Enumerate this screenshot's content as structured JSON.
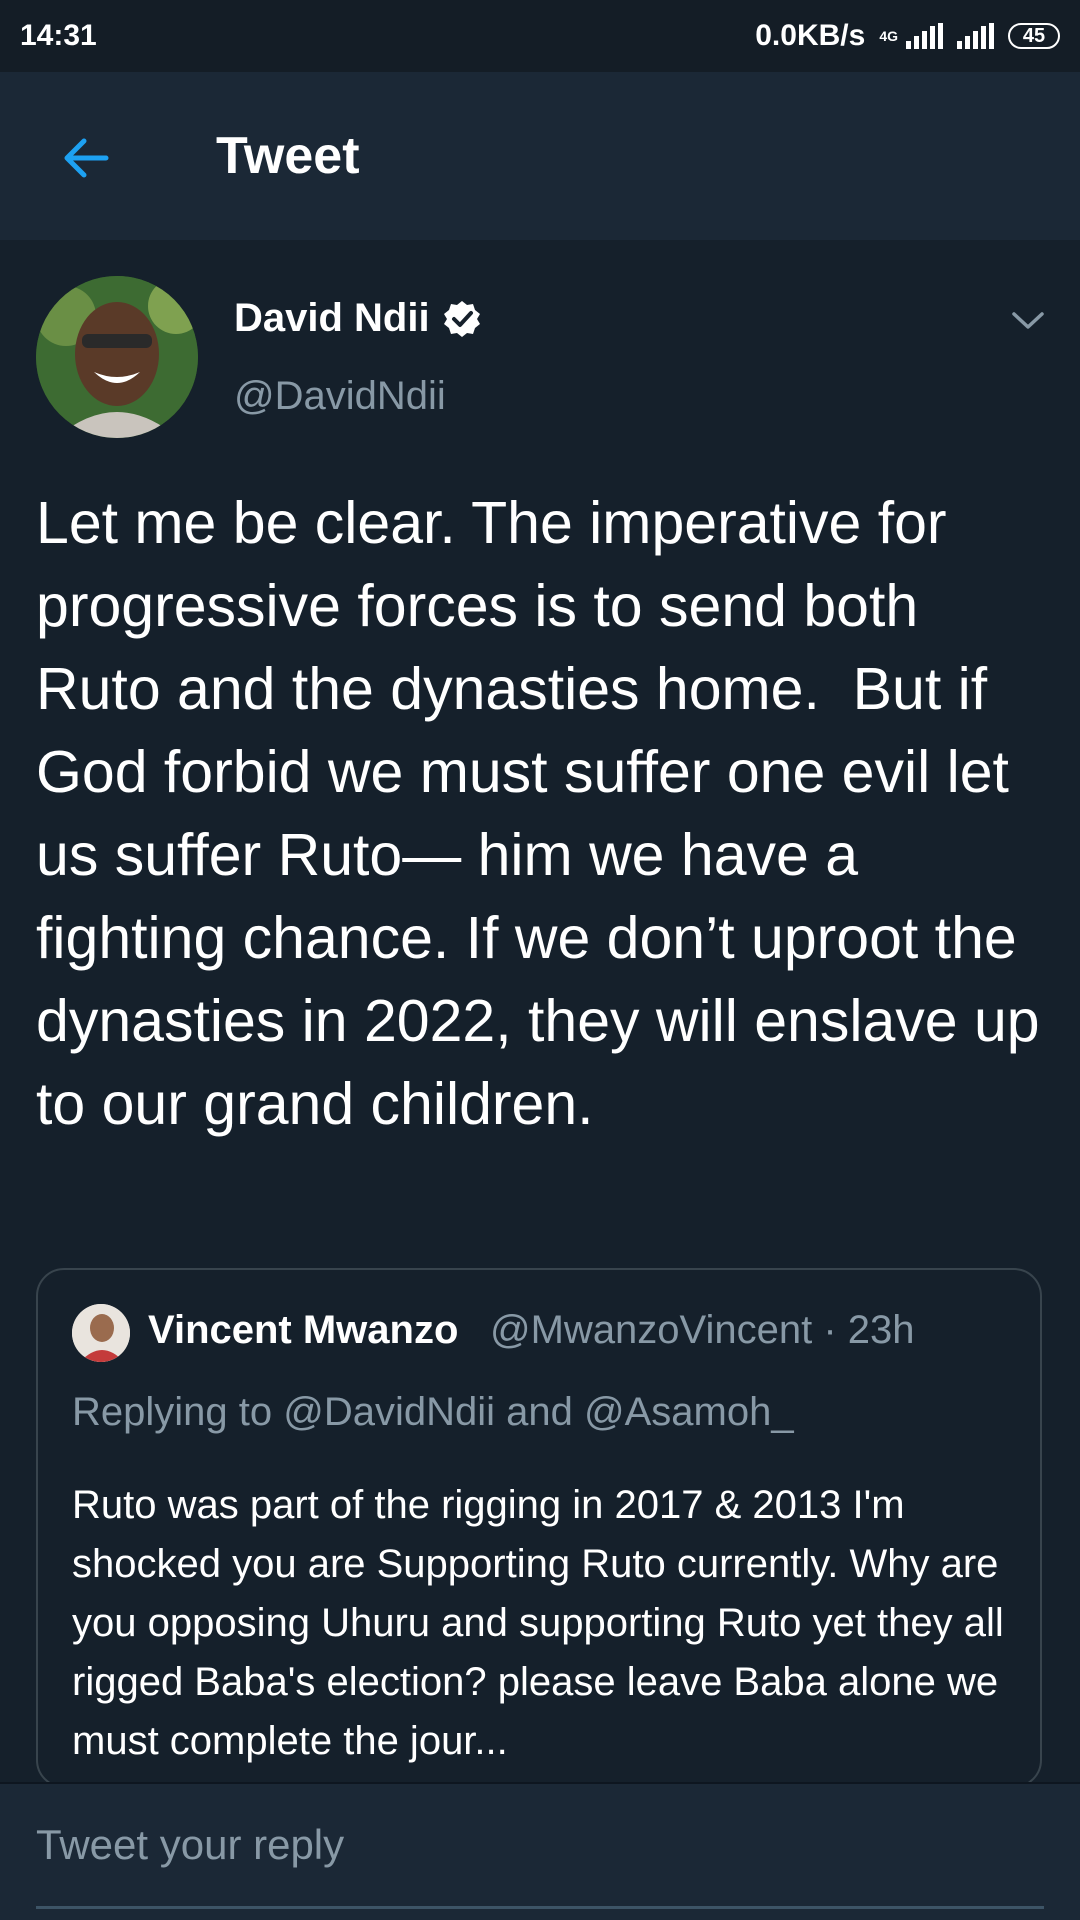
{
  "status_bar": {
    "time": "14:31",
    "network_speed": "0.0KB/s",
    "network_type": "4G",
    "battery": "45"
  },
  "header": {
    "title": "Tweet"
  },
  "tweet": {
    "author_name": "David Ndii",
    "author_handle": "@DavidNdii",
    "verified": true,
    "text": "Let me be clear. The imperative for progressive forces is to send both Ruto and the dynasties home.  But if God forbid we must suffer one evil let us suffer Ruto— him we have a fighting chance. If we don’t uproot the dynasties in 2022, they will enslave up to our grand children."
  },
  "quoted_tweet": {
    "author_name": "Vincent Mwanzo",
    "meta": "@MwanzoVincent · 23h",
    "replying_to": "Replying to @DavidNdii and @Asamoh_",
    "text": "Ruto was part of the rigging in 2017 & 2013 I'm shocked you are Supporting Ruto currently. Why are you opposing Uhuru and supporting Ruto yet they all rigged Baba's election? please leave Baba alone we must complete the jour..."
  },
  "reply": {
    "placeholder": "Tweet your reply"
  },
  "colors": {
    "background": "#15202b",
    "header": "#1b2836",
    "accent": "#1da1f2",
    "secondary_text": "#8899a6",
    "border": "#38444d"
  }
}
